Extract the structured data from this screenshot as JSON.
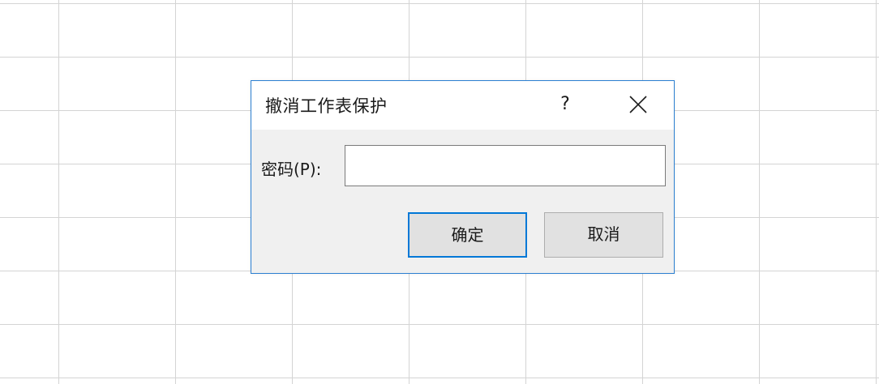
{
  "dialog": {
    "title": "撤消工作表保护",
    "help_label": "?",
    "close_icon": "close-icon",
    "password_label": "密码(P):",
    "password_value": "",
    "ok_label": "确定",
    "cancel_label": "取消",
    "accent_color": "#0078d7"
  }
}
